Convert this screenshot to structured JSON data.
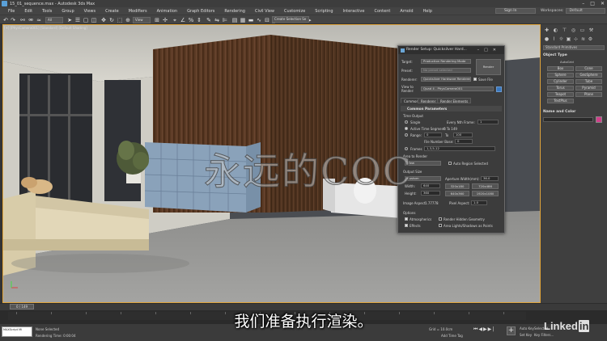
{
  "window": {
    "title": "15_01_sequence.max - Autodesk 3ds Max",
    "controls": [
      "–",
      "□",
      "✕"
    ]
  },
  "menu": [
    "File",
    "Edit",
    "Tools",
    "Group",
    "Views",
    "Create",
    "Modifiers",
    "Animation",
    "Graph Editors",
    "Rendering",
    "Civil View",
    "Customize",
    "Scripting",
    "Interactive",
    "Content",
    "Arnold",
    "Help"
  ],
  "account": {
    "sign_in": "Sign In",
    "workspaces_label": "Workspaces:",
    "workspace_value": "Default"
  },
  "toolbar": {
    "filter": "All",
    "view": "View",
    "selection_set": "Create Selection Se"
  },
  "viewport": {
    "label": "[+] [PhysCamera001] [Standard] [Default Shading]"
  },
  "command_panel": {
    "dropdown": "Standard Primitives",
    "object_type_header": "Object Type",
    "autogrid": "AutoGrid",
    "buttons": [
      "Box",
      "Cone",
      "Sphere",
      "GeoSphere",
      "Cylinder",
      "Tube",
      "Torus",
      "Pyramid",
      "Teapot",
      "Plane",
      "TextPlus"
    ],
    "name_color_header": "Name and Color",
    "name_color_value": "#d0408a"
  },
  "render_dialog": {
    "title": "Render Setup: Quicksilver Hard...",
    "target_label": "Target:",
    "target_value": "Production Rendering Mode",
    "preset_label": "Preset:",
    "preset_value": "No preset selected",
    "renderer_label": "Renderer:",
    "renderer_value": "Quicksilver Hardware Renderer",
    "save_file": "Save File",
    "view_label": "View to Render:",
    "view_value": "Quad 4 - PhysCamera001",
    "render_button": "Render",
    "tabs": [
      "Common",
      "Renderer",
      "Render Elements"
    ],
    "section_common": "Common Parameters",
    "time_output": "Time Output",
    "single": "Single",
    "every_nth": "Every Nth Frame:",
    "every_nth_value": "1",
    "active_segment": "Active Time Segment:",
    "active_segment_range": "0 To 149",
    "range": "Range:",
    "range_from": "0",
    "range_to_label": "To",
    "range_to": "100",
    "file_number_base": "File Number Base:",
    "file_number_value": "0",
    "frames": "Frames",
    "frames_value": "1,3,5-12",
    "area_to_render": "Area to Render",
    "area_value": "View",
    "auto_region": "Auto Region Selected",
    "output_size": "Output Size",
    "output_preset": "Custom",
    "aperture_label": "Aperture Width(mm):",
    "aperture_value": "36.0",
    "width_label": "Width:",
    "width_value": "640",
    "height_label": "Height:",
    "height_value": "360",
    "size_buttons": [
      "320x180",
      "720x486",
      "640x360",
      "1920x1080"
    ],
    "image_aspect_label": "Image Aspect:",
    "image_aspect_value": "1.77778",
    "pixel_aspect_label": "Pixel Aspect:",
    "pixel_aspect_value": "1.0",
    "options": "Options",
    "atmospherics": "Atmospherics",
    "render_hidden": "Render Hidden Geometry",
    "effects": "Effects",
    "area_lights": "Area Lights/Shadows as Points"
  },
  "timeline": {
    "slider": "0 / 149",
    "ticks": [
      "0",
      "10",
      "20",
      "30",
      "40",
      "50",
      "60",
      "70",
      "80",
      "90",
      "100",
      "110",
      "120",
      "130",
      "140"
    ]
  },
  "status": {
    "maxscript": "MAXScript Mi",
    "selected": "None Selected",
    "render_time": "Rendering Time: 0:00:04",
    "grid": "Grid = 10.0cm",
    "add_time_tag": "Add Time Tag",
    "auto_key": "Auto Key",
    "set_key": "Set Key",
    "selected_btn": "Selected",
    "key_filters": "Key Filters..."
  },
  "overlay": {
    "subtitle": "我们准备执行渲染。",
    "watermark": "永远的COC",
    "linkedin_text": "Linked",
    "linkedin_in": "in"
  }
}
